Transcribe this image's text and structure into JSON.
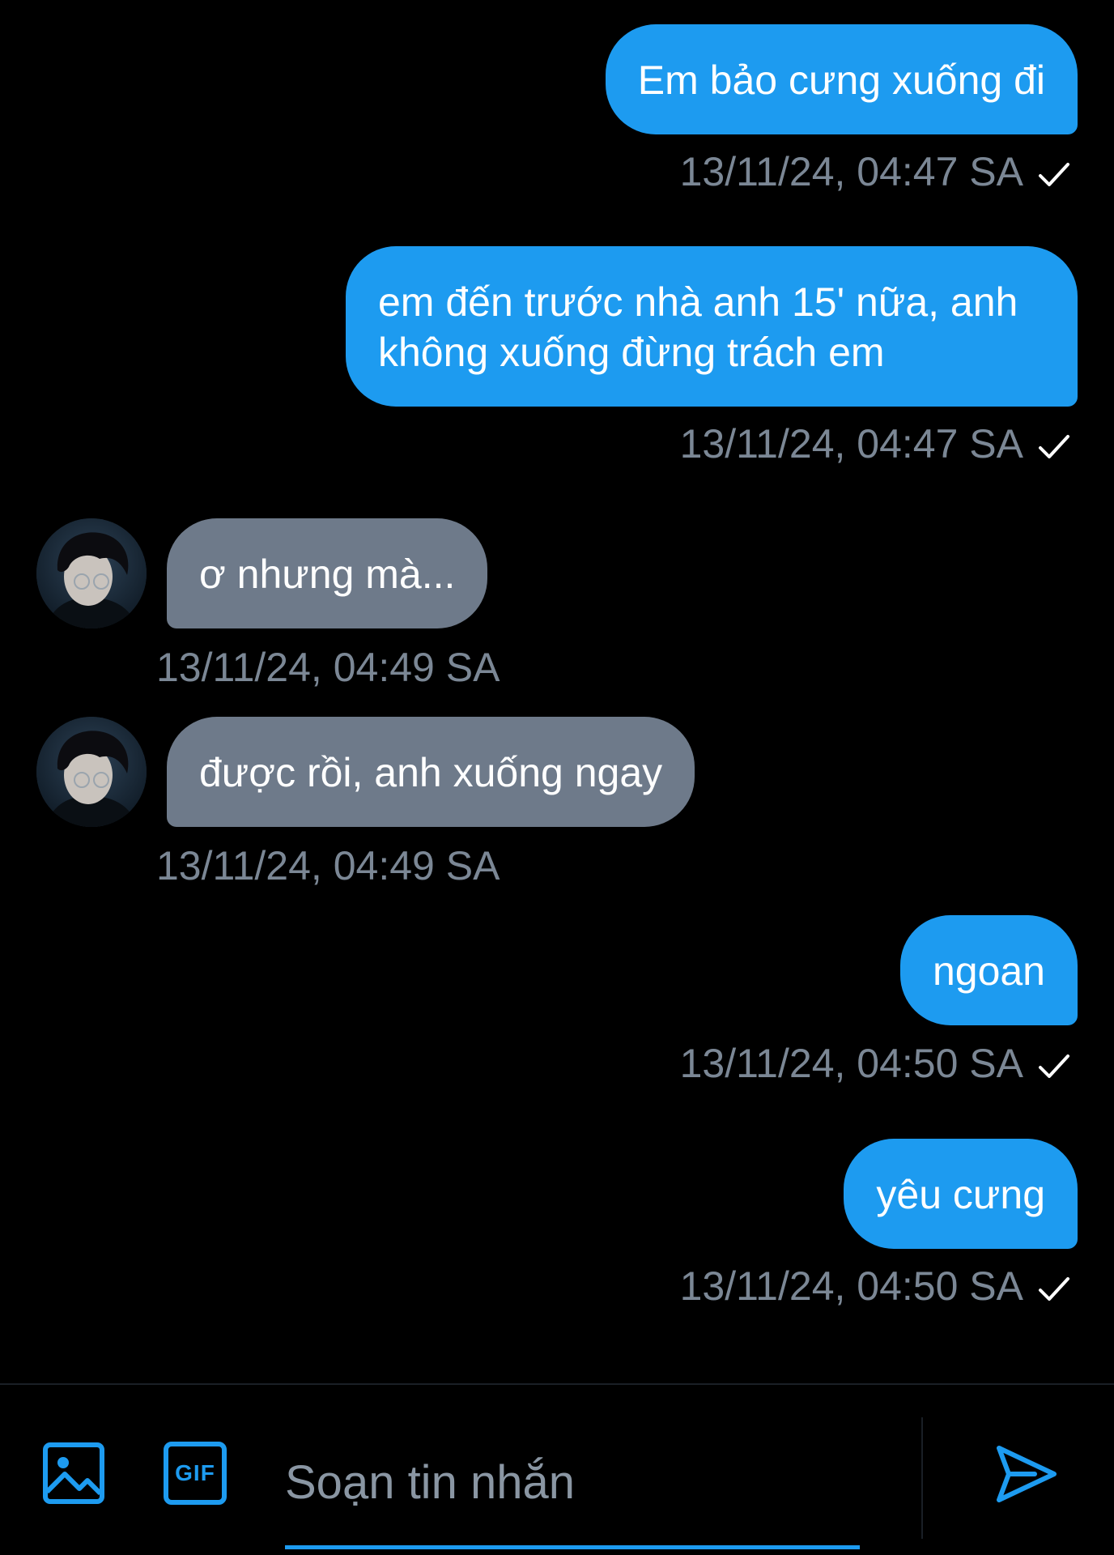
{
  "messages": [
    {
      "direction": "sent",
      "lines": [
        "Em bảo cưng xuống đi"
      ],
      "timestamp": "13/11/24, 04:47 SA",
      "status": "sent-check"
    },
    {
      "direction": "sent",
      "lines": [
        "em đến trước nhà anh 15' nữa, anh",
        "không xuống đừng trách em"
      ],
      "timestamp": "13/11/24, 04:47 SA",
      "status": "sent-check"
    },
    {
      "direction": "received",
      "lines": [
        "ơ nhưng mà..."
      ],
      "timestamp": "13/11/24, 04:49 SA"
    },
    {
      "direction": "received",
      "lines": [
        "được rồi, anh xuống ngay"
      ],
      "timestamp": "13/11/24, 04:49 SA"
    },
    {
      "direction": "sent",
      "lines": [
        "ngoan"
      ],
      "timestamp": "13/11/24, 04:50 SA",
      "status": "sent-check"
    },
    {
      "direction": "sent",
      "lines": [
        "yêu cưng"
      ],
      "timestamp": "13/11/24, 04:50 SA",
      "status": "sent-check"
    }
  ],
  "composer": {
    "placeholder": "Soạn tin nhắn",
    "value": "",
    "gif_label": "GIF",
    "media_icon": "image-icon",
    "send_icon": "send-icon"
  },
  "colors": {
    "sent_bubble": "#1d9bf0",
    "received_bubble": "#6e7a8a",
    "timestamp": "#7b8795",
    "accent": "#1d9bf0",
    "background": "#000000"
  }
}
